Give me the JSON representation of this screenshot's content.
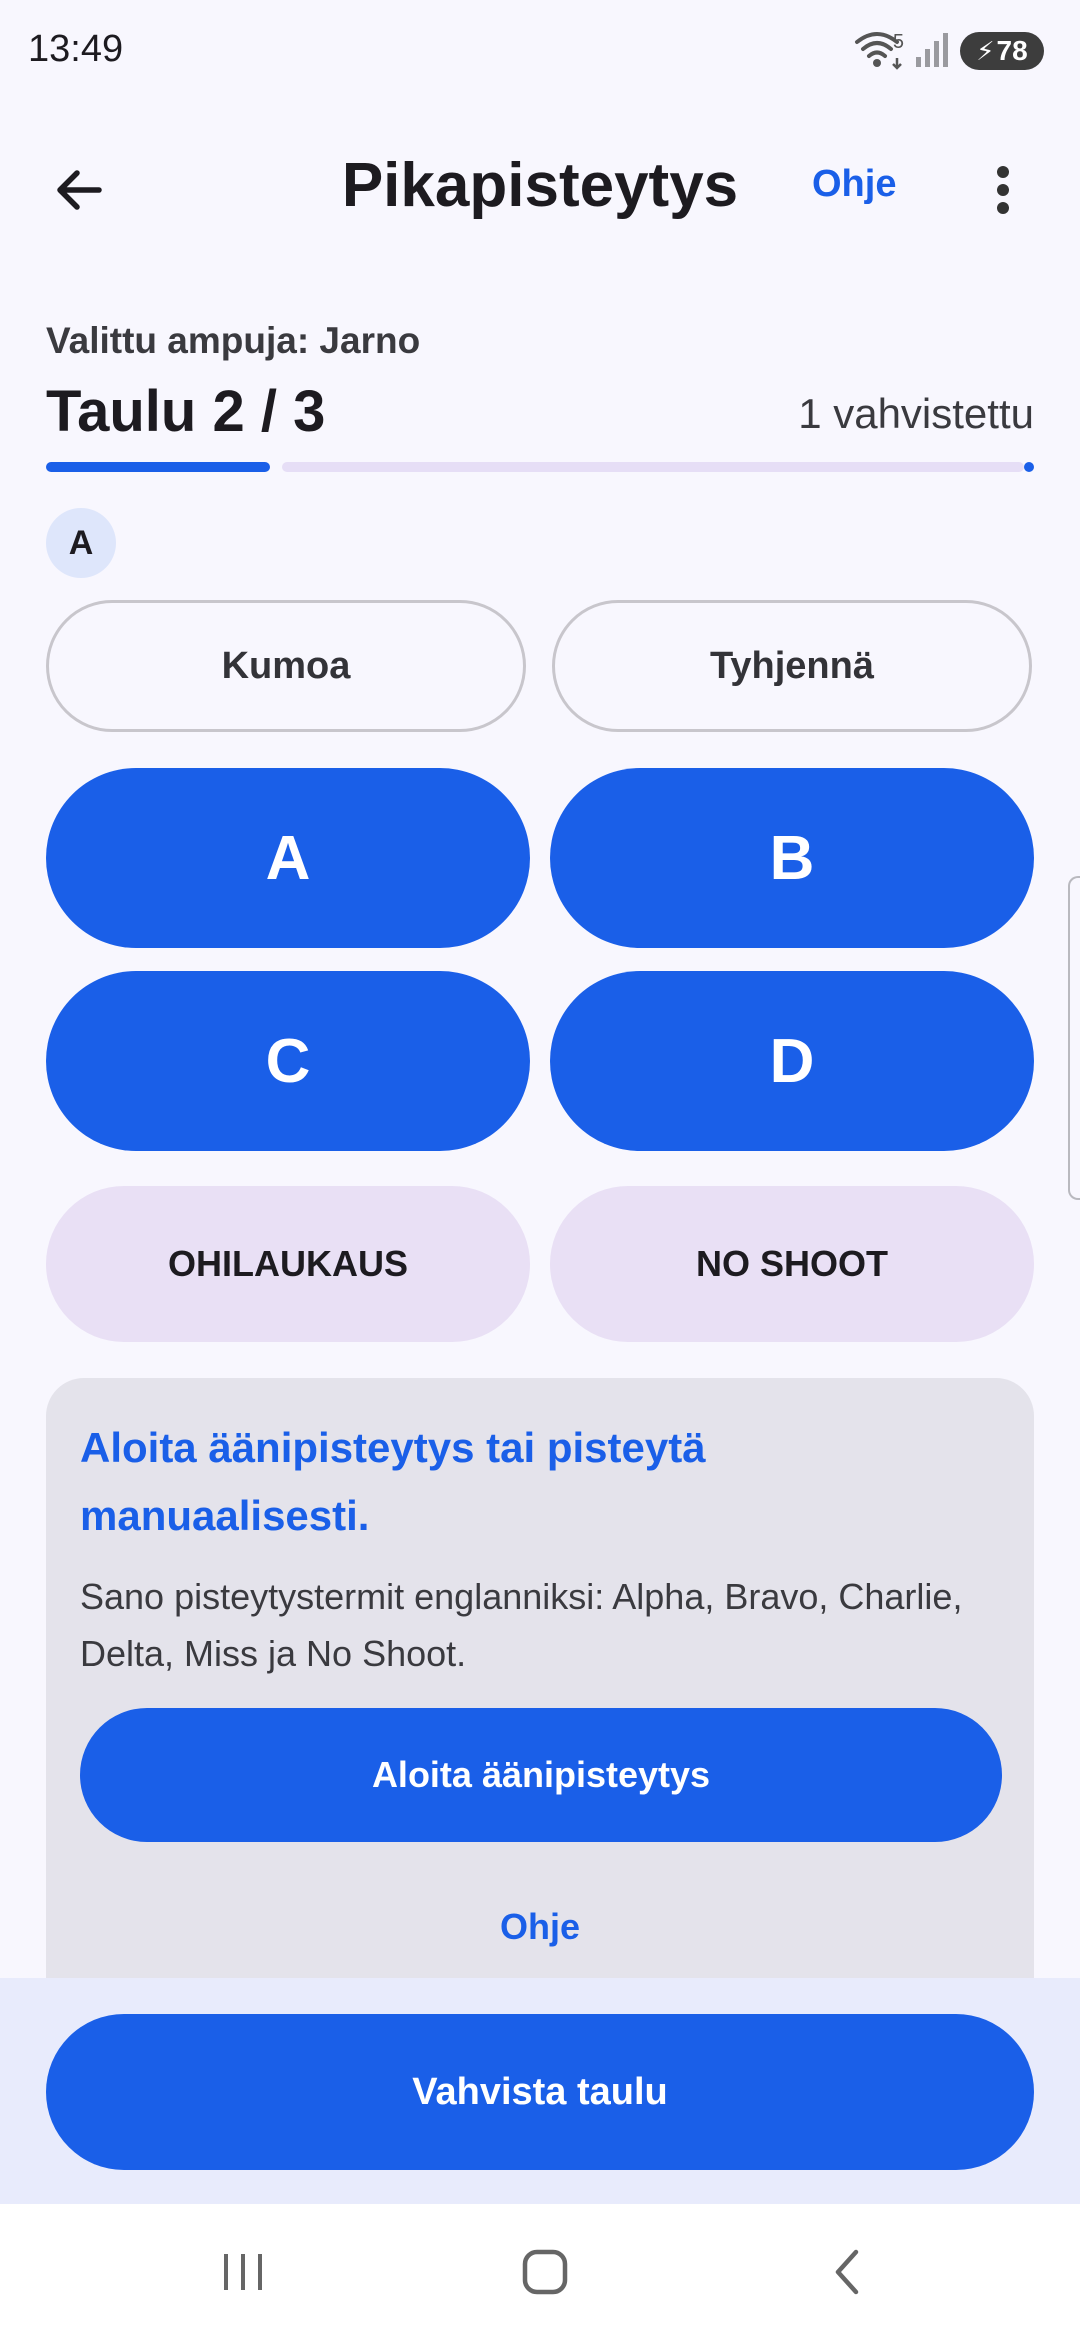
{
  "status_bar": {
    "time": "13:49",
    "wifi_badge": "5",
    "battery_level": "78",
    "icons": [
      "wifi-icon",
      "signal-icon",
      "battery-charging-icon"
    ]
  },
  "app_bar": {
    "back_icon": "arrow-back-icon",
    "title": "Pikapisteytys",
    "help_label": "Ohje",
    "more_icon": "more-vert-icon"
  },
  "session": {
    "selected_shooter": "Valittu ampuja: Jarno",
    "target_progress": "Taulu 2 / 3",
    "confirmed_count": "1 vahvistettu",
    "progress_fraction": 0.333,
    "recorded_hits": [
      "A"
    ]
  },
  "actions": {
    "undo_label": "Kumoa",
    "clear_label": "Tyhjennä"
  },
  "score_buttons": [
    {
      "label": "A"
    },
    {
      "label": "B"
    },
    {
      "label": "C"
    },
    {
      "label": "D"
    }
  ],
  "secondary_buttons": {
    "miss_label": "OHILAUKAUS",
    "no_shoot_label": "NO SHOOT"
  },
  "voice_card": {
    "title": "Aloita äänipisteytys tai pisteytä manuaalisesti.",
    "description": "Sano pisteytystermit englanniksi: Alpha, Bravo, Charlie, Delta, Miss ja No Shoot.",
    "start_label": "Aloita äänipisteytys",
    "help_label": "Ohje"
  },
  "footer": {
    "confirm_label": "Vahvista taulu"
  },
  "nav_bar": {
    "icons": [
      "recents-icon",
      "home-icon",
      "back-icon"
    ]
  },
  "colors": {
    "primary": "#1a5fe8",
    "background": "#f8f7fe",
    "tonal": "#e9e0f5",
    "card": "#e4e3eb"
  }
}
